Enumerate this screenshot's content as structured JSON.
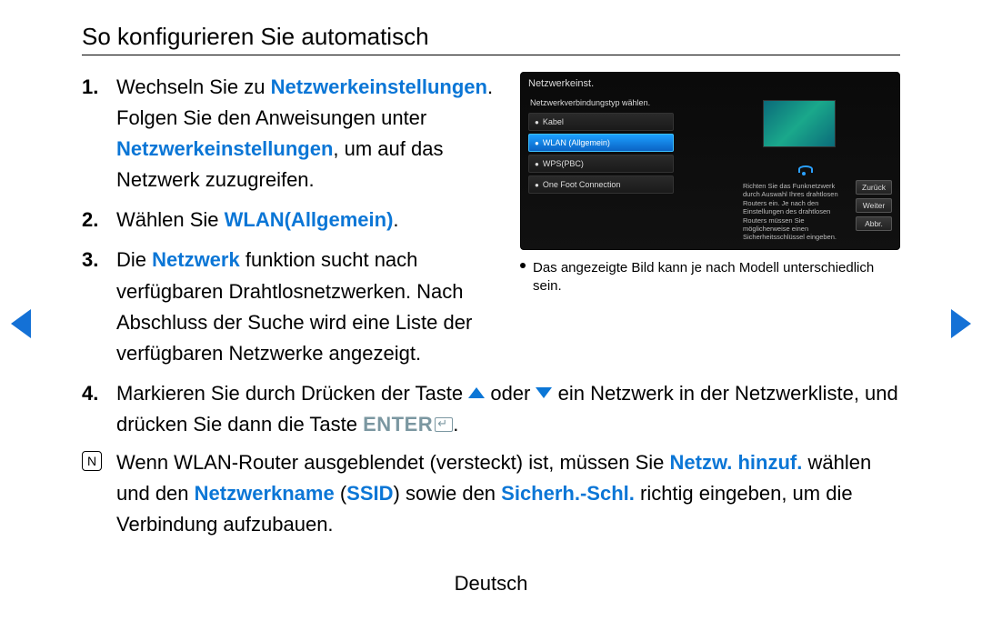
{
  "title": "So konfigurieren Sie automatisch",
  "steps": {
    "s1": {
      "a": "Wechseln Sie zu ",
      "hl1": "Netzwerkeinstellungen",
      "b": ". Folgen Sie den Anweisungen unter ",
      "hl2": "Netzwerkeinstellungen",
      "c": ", um auf das Netzwerk zuzugreifen."
    },
    "s2": {
      "a": "Wählen Sie ",
      "hl1": "WLAN(Allgemein)",
      "b": "."
    },
    "s3": {
      "a": "Die ",
      "hl1": "Netzwerk",
      "b": " funktion sucht nach verfügbaren Drahtlosnetzwerken. Nach Abschluss der Suche wird eine Liste der verfügbaren Netzwerke angezeigt."
    },
    "s4": {
      "a": "Markieren Sie durch Drücken der Taste ",
      "mid": " oder ",
      "b": " ein Netzwerk in der Netzwerkliste, und drücken Sie dann die Taste ",
      "enter": "ENTER",
      "c": "."
    }
  },
  "note": {
    "a": "Wenn WLAN-Router ausgeblendet (versteckt) ist, müssen Sie ",
    "hl1": "Netzw. hinzuf.",
    "b": " wählen und den ",
    "hl2": "Netzwerkname",
    "paren_l": " (",
    "hl3": "SSID",
    "paren_r": ") sowie den ",
    "hl4": "Sicherh.-Schl.",
    "c": " richtig eingeben, um die Verbindung aufzubauen."
  },
  "device": {
    "title": "Netzwerkeinst.",
    "subtitle": "Netzwerkverbindungstyp wählen.",
    "items": [
      "Kabel",
      "WLAN (Allgemein)",
      "WPS(PBC)",
      "One Foot Connection"
    ],
    "desc": "Richten Sie das Funknetzwerk durch Auswahl Ihres drahtlosen Routers ein. Je nach den Einstellungen des drahtlosen Routers müssen Sie möglicherweise einen Sicherheitsschlüssel eingeben.",
    "buttons": [
      "Zurück",
      "Weiter",
      "Abbr."
    ]
  },
  "caption": "Das angezeigte Bild kann je nach Modell unterschiedlich sein.",
  "language": "Deutsch"
}
